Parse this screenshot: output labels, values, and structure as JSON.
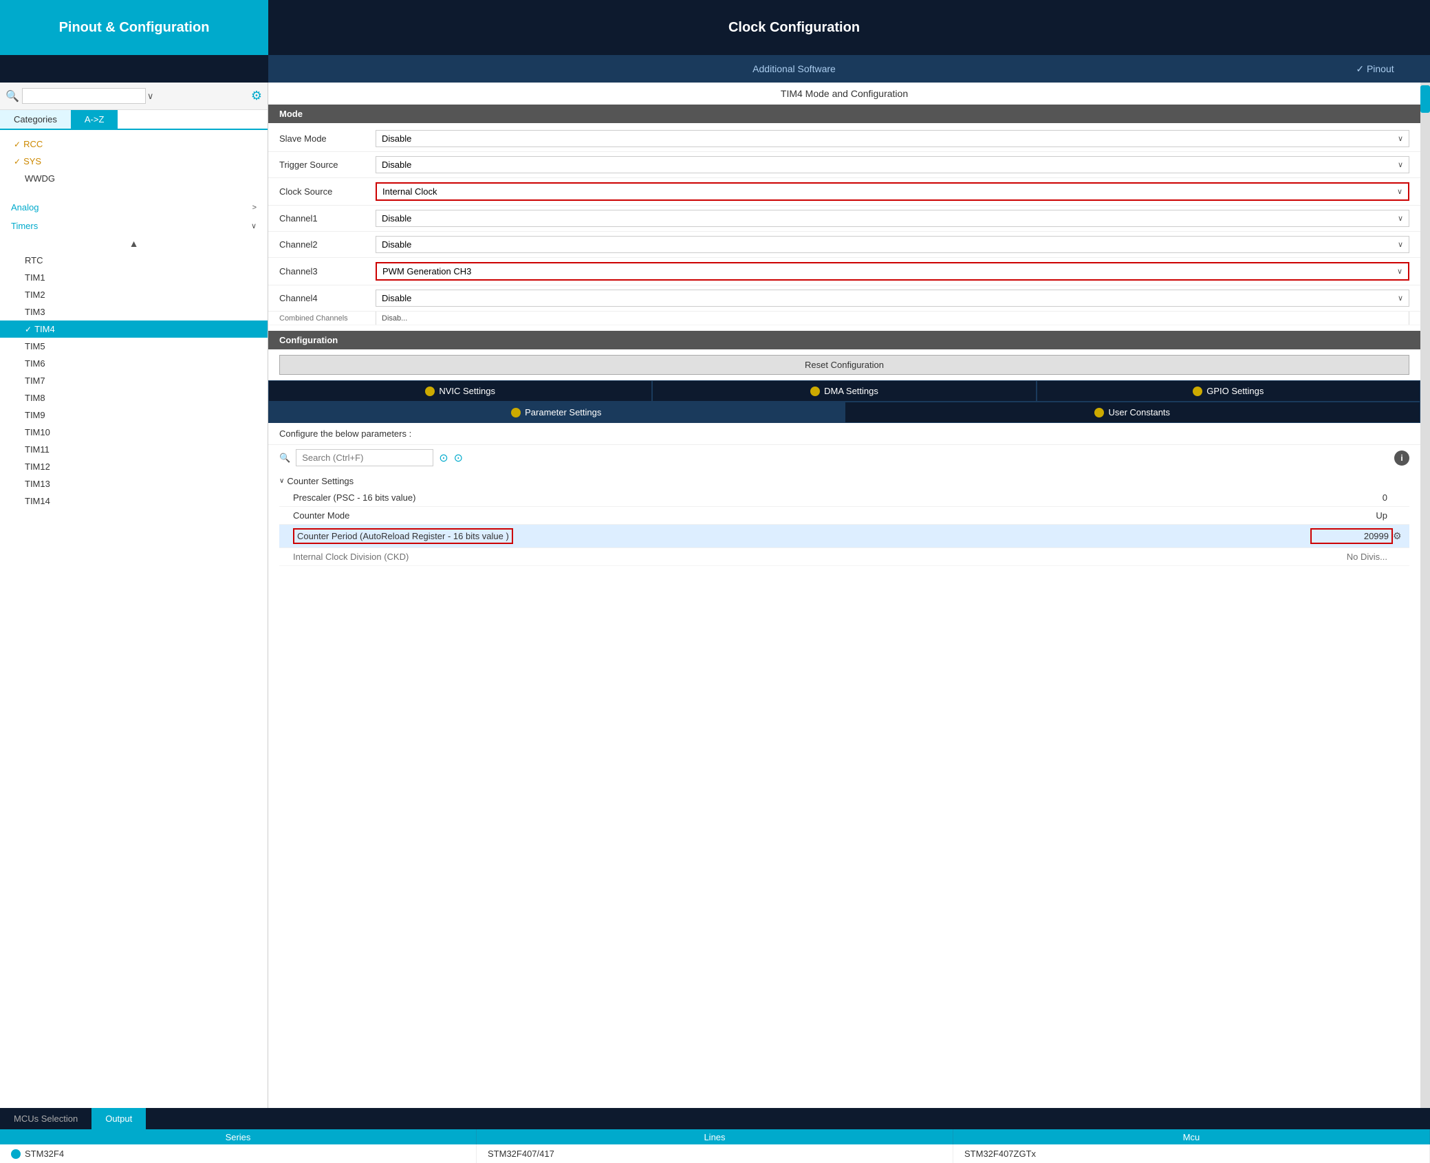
{
  "header": {
    "pinout_label": "Pinout & Configuration",
    "clock_label": "Clock Configuration",
    "additional_software": "Additional Software",
    "pinout_link": "✓ Pinout"
  },
  "sidebar": {
    "search_placeholder": "",
    "search_dropdown": "∨",
    "tabs": [
      {
        "label": "Categories",
        "active": false
      },
      {
        "label": "A->Z",
        "active": true
      }
    ],
    "items": [
      {
        "label": "RCC",
        "checked": true,
        "indent": false,
        "selected": false
      },
      {
        "label": "SYS",
        "checked": true,
        "indent": false,
        "selected": false
      },
      {
        "label": "WWDG",
        "checked": false,
        "indent": false,
        "selected": false
      }
    ],
    "categories": [
      {
        "label": "Analog",
        "expanded": false
      },
      {
        "label": "Timers",
        "expanded": true
      }
    ],
    "timer_items": [
      {
        "label": "RTC",
        "selected": false
      },
      {
        "label": "TIM1",
        "selected": false
      },
      {
        "label": "TIM2",
        "selected": false
      },
      {
        "label": "TIM3",
        "selected": false
      },
      {
        "label": "TIM4",
        "selected": true,
        "checked": true
      },
      {
        "label": "TIM5",
        "selected": false
      },
      {
        "label": "TIM6",
        "selected": false
      },
      {
        "label": "TIM7",
        "selected": false
      },
      {
        "label": "TIM8",
        "selected": false
      },
      {
        "label": "TIM9",
        "selected": false
      },
      {
        "label": "TIM10",
        "selected": false
      },
      {
        "label": "TIM11",
        "selected": false
      },
      {
        "label": "TIM12",
        "selected": false
      },
      {
        "label": "TIM13",
        "selected": false
      },
      {
        "label": "TIM14",
        "selected": false
      }
    ]
  },
  "main": {
    "section_title": "TIM4 Mode and Configuration",
    "mode_header": "Mode",
    "mode_rows": [
      {
        "label": "Slave Mode",
        "value": "Disable",
        "highlighted": false
      },
      {
        "label": "Trigger Source",
        "value": "Disable",
        "highlighted": false
      },
      {
        "label": "Clock Source",
        "value": "Internal Clock",
        "highlighted": true
      },
      {
        "label": "Channel1",
        "value": "Disable",
        "highlighted": false
      },
      {
        "label": "Channel2",
        "value": "Disable",
        "highlighted": false
      },
      {
        "label": "Channel3",
        "value": "PWM Generation CH3",
        "highlighted": true
      },
      {
        "label": "Channel4",
        "value": "Disable",
        "highlighted": false
      },
      {
        "label": "Combined Channels",
        "value": "Disable",
        "highlighted": false,
        "partial": true
      }
    ],
    "config_header": "Configuration",
    "reset_btn": "Reset Configuration",
    "config_tabs_row1": [
      {
        "label": "NVIC Settings",
        "active": false
      },
      {
        "label": "DMA Settings",
        "active": false
      },
      {
        "label": "GPIO Settings",
        "active": false
      }
    ],
    "config_tabs_row2": [
      {
        "label": "Parameter Settings",
        "active": true
      },
      {
        "label": "User Constants",
        "active": false
      }
    ],
    "params_desc": "Configure the below parameters :",
    "search_placeholder": "Search (Ctrl+F)",
    "counter_settings_title": "Counter Settings",
    "params": [
      {
        "label": "Prescaler (PSC - 16 bits value)",
        "value": "0",
        "highlighted": false
      },
      {
        "label": "Counter Mode",
        "value": "Up",
        "highlighted": false
      },
      {
        "label": "Counter Period (AutoReload Register - 16 bits value )",
        "value": "20999",
        "highlighted": true
      },
      {
        "label": "Internal Clock Division (CKD)",
        "value": "No Divis...",
        "highlighted": false,
        "partial": true
      }
    ]
  },
  "bottom": {
    "tabs": [
      {
        "label": "MCUs Selection",
        "active": false
      },
      {
        "label": "Output",
        "active": true
      }
    ],
    "table_cols": [
      "Series",
      "Lines",
      "Mcu"
    ],
    "table_rows": [
      {
        "series": "STM32F4",
        "lines": "STM32F407/417",
        "mcu": "STM32F407ZGTx",
        "has_dot": true
      }
    ]
  }
}
